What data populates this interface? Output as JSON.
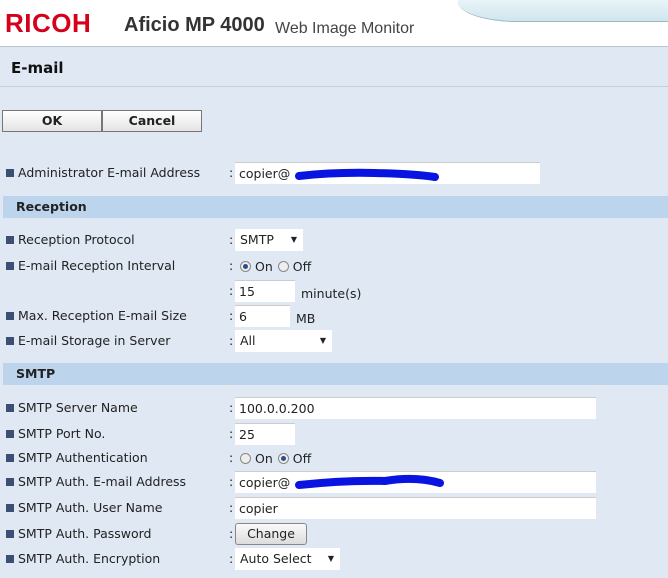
{
  "header": {
    "brand": "RICOH",
    "model": "Aficio MP 4000",
    "app": "Web Image Monitor"
  },
  "page_title": "E-mail",
  "buttons": {
    "ok": "OK",
    "cancel": "Cancel"
  },
  "colon": ":",
  "admin": {
    "label": "Administrator E-mail Address",
    "value": "copier@"
  },
  "reception": {
    "heading": "Reception",
    "protocol": {
      "label": "Reception Protocol",
      "value": "SMTP"
    },
    "interval": {
      "label": "E-mail Reception Interval",
      "on": "On",
      "off": "Off",
      "selected": "On",
      "minutes": "15",
      "unit": "minute(s)"
    },
    "max_size": {
      "label": "Max. Reception E-mail Size",
      "value": "6",
      "unit": "MB"
    },
    "storage": {
      "label": "E-mail Storage in Server",
      "value": "All"
    }
  },
  "smtp": {
    "heading": "SMTP",
    "server": {
      "label": "SMTP Server Name",
      "value": "100.0.0.200"
    },
    "port": {
      "label": "SMTP Port No.",
      "value": "25"
    },
    "auth": {
      "label": "SMTP Authentication",
      "on": "On",
      "off": "Off",
      "selected": "Off"
    },
    "auth_email": {
      "label": "SMTP Auth. E-mail Address",
      "value": "copier@"
    },
    "user": {
      "label": "SMTP Auth. User Name",
      "value": "copier"
    },
    "password": {
      "label": "SMTP Auth. Password",
      "button": "Change"
    },
    "encryption": {
      "label": "SMTP Auth. Encryption",
      "value": "Auto Select"
    }
  },
  "colors": {
    "brand": "#d7001b",
    "background": "#dfe8f3",
    "section": "#bcd5ec",
    "redaction": "#0a14e0"
  }
}
